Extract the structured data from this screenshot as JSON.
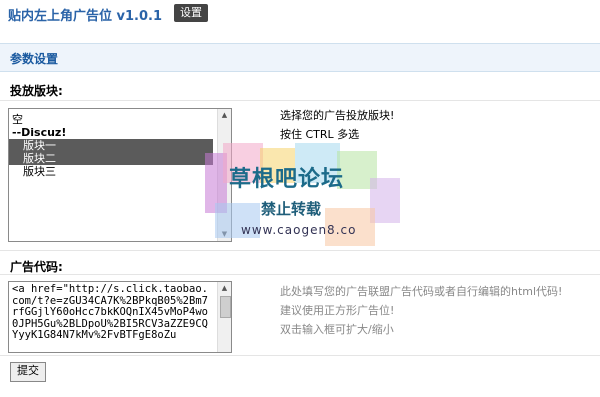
{
  "header": {
    "title": "贴内左上角广告位 v1.0.1",
    "settings_label": "设置"
  },
  "section": {
    "title": "参数设置"
  },
  "placement": {
    "label": "投放版块:",
    "options": [
      {
        "text": "空",
        "style": "normal"
      },
      {
        "text": "--Discuz!",
        "style": "bold"
      },
      {
        "text": "版块一",
        "style": "selected"
      },
      {
        "text": "版块二",
        "style": "selected"
      },
      {
        "text": "版块三",
        "style": "indent"
      }
    ],
    "help_line1": "选择您的广告投放版块!",
    "help_line2": "按住 CTRL 多选"
  },
  "adcode": {
    "label": "广告代码:",
    "value": "<a href=\"http://s.click.taobao.com/t?e=zGU34CA7K%2BPkqB05%2Bm7rfGGjlY60oHcc7bkKOQnIX45vMoP4wo0JPH5Gu%2BLDpoU%2BI5RCV3aZZE9CQYyyK1G84N7kMv%2FvBTFgE8oZu",
    "help_line1": "此处填写您的广告联盟广告代码或者自行编辑的html代码!",
    "help_line2": "建议使用正方形广告位!",
    "help_line3": "双击输入框可扩大/缩小"
  },
  "actions": {
    "submit_label": "提交"
  },
  "watermark": {
    "title": "草根吧论坛",
    "subtitle": "禁止转载",
    "url": "www.caogen8.co"
  }
}
